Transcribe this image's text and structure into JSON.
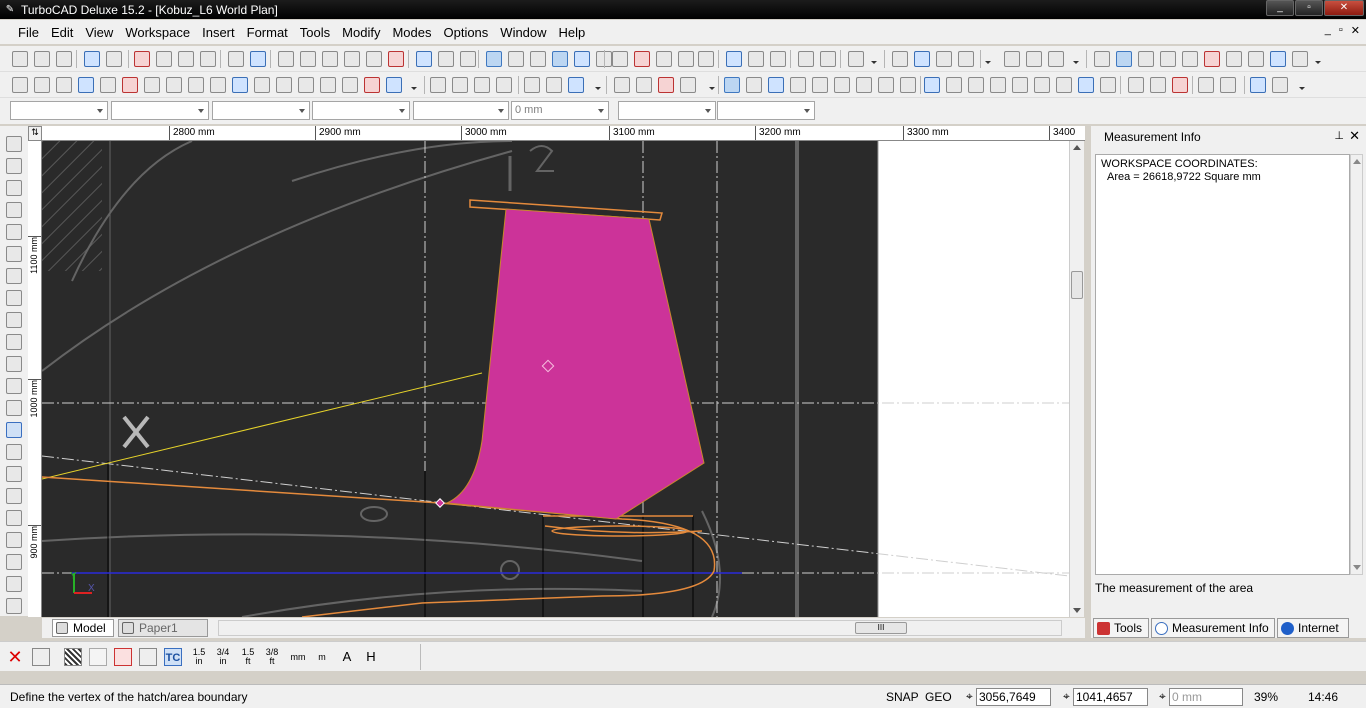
{
  "window": {
    "title": "TurboCAD Deluxe 15.2 - [Kobuz_L6 World Plan]",
    "controls": [
      "_",
      "▫",
      "✕"
    ]
  },
  "menubar": {
    "items": [
      "File",
      "Edit",
      "View",
      "Workspace",
      "Insert",
      "Format",
      "Tools",
      "Modify",
      "Modes",
      "Options",
      "Window",
      "Help"
    ],
    "doc_controls": [
      "_",
      "▫",
      "✕"
    ]
  },
  "propbar": {
    "z_value": "0 mm"
  },
  "ruler_h": {
    "labels": [
      "2800 mm",
      "2900 mm",
      "3000 mm",
      "3100 mm",
      "3200 mm",
      "3300 mm",
      "3400 m"
    ]
  },
  "ruler_v": {
    "labels": [
      "1100 mm",
      "1000 mm",
      "900 mm"
    ]
  },
  "tabs": {
    "model": "Model",
    "paper": "Paper1"
  },
  "hscroll": {
    "thumb_label": "III"
  },
  "canvas": {
    "axis_y": "Y",
    "axis_x": "X",
    "hatch_color": "#cc3399",
    "bg_color": "#2a2a2a"
  },
  "context_toolbar": {
    "icons": [
      "1.5 in",
      "3/4 in",
      "1.5 ft",
      "3/8 ft",
      "mm",
      "m",
      "A",
      "H"
    ]
  },
  "statusbar": {
    "prompt": "Define the vertex of the hatch/area boundary",
    "snap": "SNAP",
    "geo": "GEO",
    "x_value": "3056,7649 mm",
    "y_value": "1041,4657 mm",
    "z_value": "0 mm",
    "zoom": "39%",
    "time": "14:46"
  },
  "panel": {
    "title": "Measurement Info",
    "line1": "WORKSPACE COORDINATES:",
    "line2": "Area = 26618,9722  Square mm",
    "footer": "The measurement of the area",
    "tabs": [
      "Tools",
      "Measurement Info",
      "Internet"
    ]
  }
}
